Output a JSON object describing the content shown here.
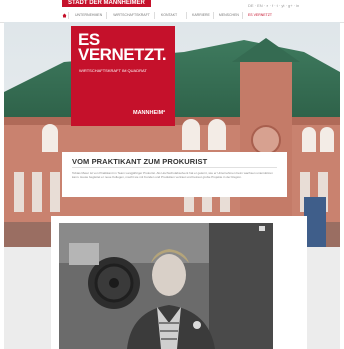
{
  "header": {
    "title": "STADT DER MANNHEIMER",
    "utility_links": "DE · EN · ⌕ · f · t · yt · g+ · in"
  },
  "nav": {
    "primary": [
      "UNTERNEHMEN",
      "WIRTSCHAFTSKRAFT",
      "KONTAKT"
    ],
    "secondary": [
      "KARRIERE",
      "MENSCHEN",
      "ES VERNETZT"
    ],
    "active_secondary_index": 2
  },
  "promo": {
    "headline_line1": "ES",
    "headline_line2": "VERNETZT.",
    "subline": "WIRTSCHAFTSKRAFT IM QUADRAT",
    "brand": "MANNHEIM²",
    "color": "#c5112b"
  },
  "article": {
    "title": "VOM PRAKTIKANT ZUM PROKURIST",
    "body": "Tobias Meier ist von Praktikant im Team Langjähriger Prokurist. Als Hochschulabsolvent hat er gelernt, wie er Unternehmen beim wachsen unterstützen kann. Heute begleitet er neue Kollegen, macht sie mit Kunden und Produkten vertraut und betreut große Projekte in der Region."
  },
  "colors": {
    "accent": "#c5112b"
  }
}
